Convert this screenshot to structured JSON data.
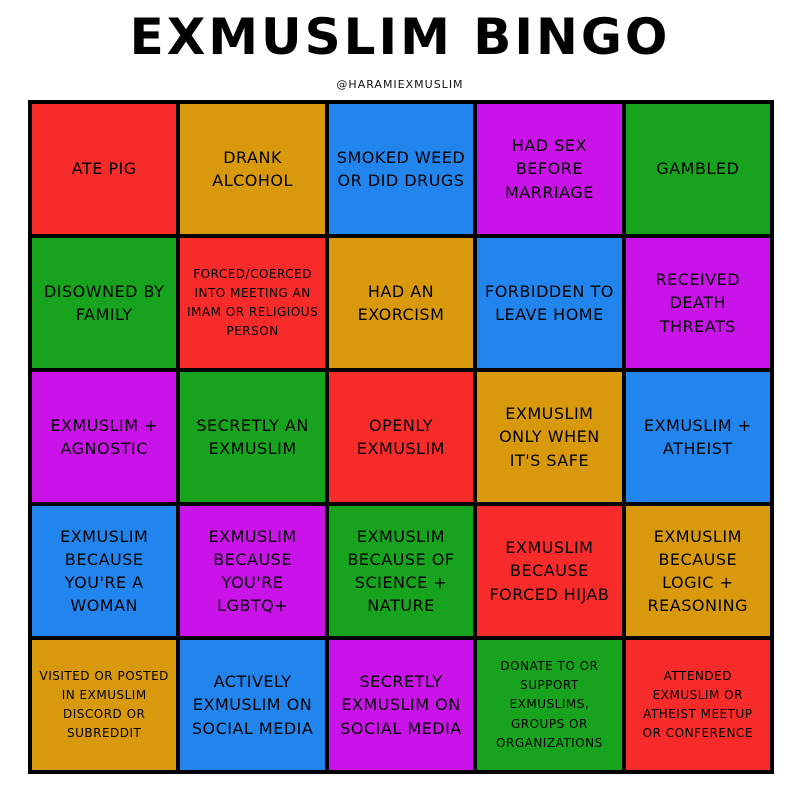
{
  "title": "EXMUSLIM BINGO",
  "handle": "@HARAMIEXMUSLIM",
  "colors": {
    "red": "#f82b2b",
    "gold": "#d89a0c",
    "blue": "#2285ee",
    "purple": "#c913e8",
    "green": "#17a31d"
  },
  "cells": [
    {
      "label": "ATE PIG",
      "color": "red"
    },
    {
      "label": "DRANK ALCOHOL",
      "color": "gold"
    },
    {
      "label": "SMOKED WEED OR DID DRUGS",
      "color": "blue"
    },
    {
      "label": "HAD SEX BEFORE MARRIAGE",
      "color": "purple"
    },
    {
      "label": "GAMBLED",
      "color": "green"
    },
    {
      "label": "DISOWNED BY FAMILY",
      "color": "green"
    },
    {
      "label": "FORCED/COERCED INTO MEETING AN IMAM OR RELIGIOUS PERSON",
      "color": "red"
    },
    {
      "label": "HAD AN EXORCISM",
      "color": "gold"
    },
    {
      "label": "FORBIDDEN TO LEAVE HOME",
      "color": "blue"
    },
    {
      "label": "RECEIVED DEATH THREATS",
      "color": "purple"
    },
    {
      "label": "EXMUSLIM + AGNOSTIC",
      "color": "purple"
    },
    {
      "label": "SECRETLY AN EXMUSLIM",
      "color": "green"
    },
    {
      "label": "OPENLY EXMUSLIM",
      "color": "red"
    },
    {
      "label": "EXMUSLIM ONLY WHEN IT'S SAFE",
      "color": "gold"
    },
    {
      "label": "EXMUSLIM + ATHEIST",
      "color": "blue"
    },
    {
      "label": "EXMUSLIM BECAUSE YOU'RE A WOMAN",
      "color": "blue"
    },
    {
      "label": "EXMUSLIM BECAUSE YOU'RE LGBTQ+",
      "color": "purple"
    },
    {
      "label": "EXMUSLIM BECAUSE OF SCIENCE + NATURE",
      "color": "green"
    },
    {
      "label": "EXMUSLIM BECAUSE FORCED HIJAB",
      "color": "red"
    },
    {
      "label": "EXMUSLIM BECAUSE LOGIC + REASONING",
      "color": "gold"
    },
    {
      "label": "VISITED OR POSTED IN EXMUSLIM DISCORD OR SUBREDDIT",
      "color": "gold"
    },
    {
      "label": "ACTIVELY EXMUSLIM ON SOCIAL MEDIA",
      "color": "blue"
    },
    {
      "label": "SECRETLY EXMUSLIM ON SOCIAL MEDIA",
      "color": "purple"
    },
    {
      "label": "DONATE TO OR SUPPORT EXMUSLIMS, GROUPS OR ORGANIZATIONS",
      "color": "green"
    },
    {
      "label": "ATTENDED EXMUSLIM OR ATHEIST MEETUP OR CONFERENCE",
      "color": "red"
    }
  ]
}
